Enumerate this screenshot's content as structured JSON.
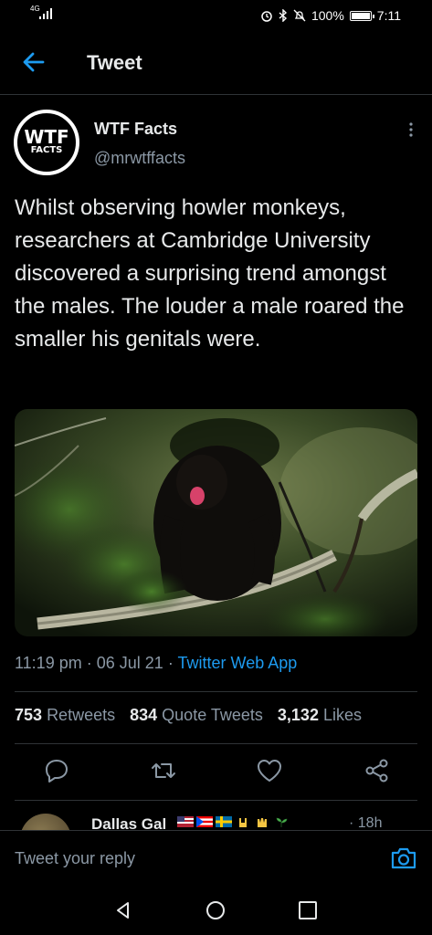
{
  "status_bar": {
    "network": "4G",
    "battery": "100%",
    "time": "7:11",
    "battery_level": 1.0
  },
  "header": {
    "title": "Tweet"
  },
  "tweet": {
    "author": {
      "name": "WTF Facts",
      "handle": "@mrwtffacts",
      "avatar_line1": "WTF",
      "avatar_line2": "FACTS"
    },
    "text": "Whilst observing howler monkeys, researchers at Cambridge University discovered a surprising trend amongst the males. The louder a male roared the smaller his genitals were.",
    "time": "11:19 pm",
    "separator": "·",
    "date": "06 Jul 21",
    "source": "Twitter Web App",
    "stats": {
      "retweets_count": "753",
      "retweets_label": "Retweets",
      "quotes_count": "834",
      "quotes_label": "Quote Tweets",
      "likes_count": "3,132",
      "likes_label": "Likes"
    }
  },
  "reply_preview": {
    "name": "Dallas Gal",
    "time": "· 18h"
  },
  "reply_bar": {
    "placeholder": "Tweet your reply"
  },
  "colors": {
    "background": "#000000",
    "accent": "#1d9bf0",
    "text": "#e7e9ea",
    "muted": "#8b98a5",
    "divider": "#2f3336"
  },
  "icons": {
    "back": "arrow-left-icon",
    "more": "more-vertical-icon",
    "reply": "reply-icon",
    "retweet": "retweet-icon",
    "like": "heart-icon",
    "share": "share-icon",
    "camera": "camera-icon"
  }
}
